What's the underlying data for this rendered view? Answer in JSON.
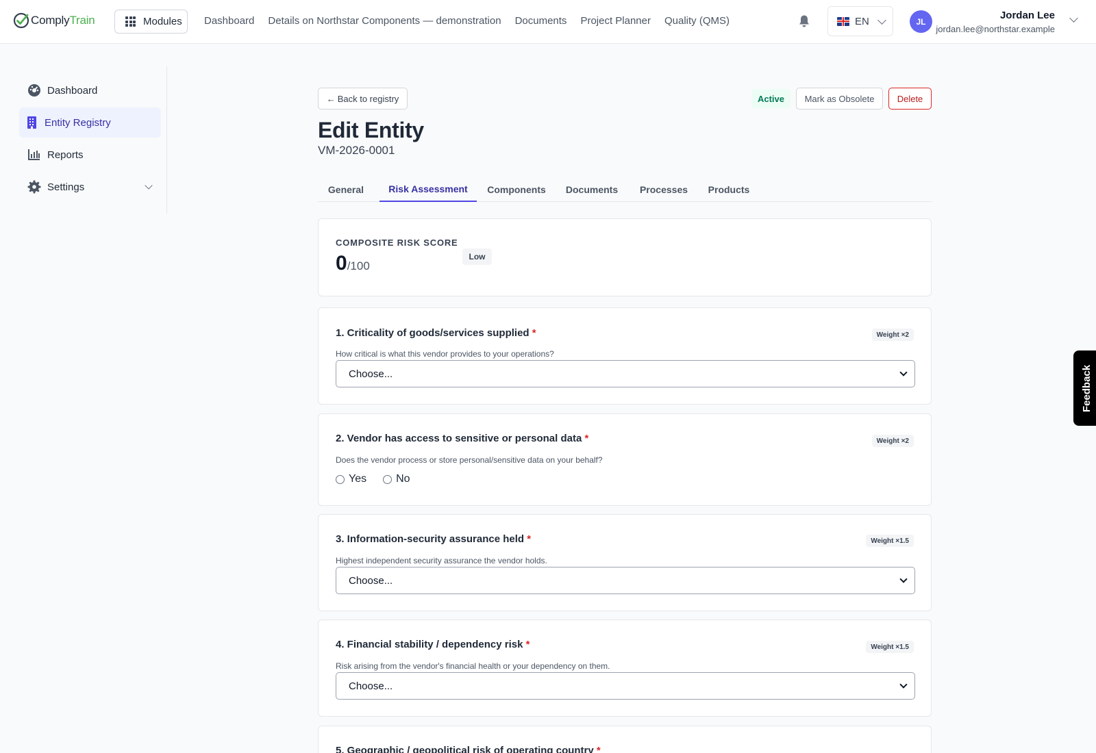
{
  "app": {
    "logo_part1": "Comply",
    "logo_part2": "Train",
    "modules_label": "Modules",
    "nav": [
      "Dashboard",
      "Details on Northstar Components — demonstration",
      "Documents",
      "Project Planner",
      "Quality (QMS)"
    ],
    "language": "EN",
    "user": {
      "initials": "JL",
      "name": "Jordan Lee",
      "email": "jordan.lee@northstar.example"
    }
  },
  "sidebar": {
    "items": [
      {
        "label": "Dashboard",
        "icon": "dashboard-icon"
      },
      {
        "label": "Entity Registry",
        "icon": "building-icon",
        "active": true
      },
      {
        "label": "Reports",
        "icon": "bar-chart-icon"
      },
      {
        "label": "Settings",
        "icon": "gear-icon"
      }
    ]
  },
  "header": {
    "back_label": "Back to registry",
    "status": "Active",
    "obsolete_label": "Mark as Obsolete",
    "delete_label": "Delete",
    "title": "Edit Entity",
    "entity_id": "VM-2026-0001"
  },
  "tabs": [
    "General",
    "Risk Assessment",
    "Components",
    "Documents",
    "Processes",
    "Products"
  ],
  "active_tab": "Risk Assessment",
  "score": {
    "label": "COMPOSITE RISK SCORE",
    "value": "0",
    "max": "/100",
    "level": "Low"
  },
  "questions": [
    {
      "title": "1. Criticality of goods/services supplied",
      "required": "*",
      "weight": "Weight ×2",
      "help": "How critical is what this vendor provides to your operations?",
      "type": "select",
      "value": "Choose..."
    },
    {
      "title": "2. Vendor has access to sensitive or personal data",
      "required": "*",
      "weight": "Weight ×2",
      "help": "Does the vendor process or store personal/sensitive data on your behalf?",
      "type": "radio",
      "options": [
        "Yes",
        "No"
      ]
    },
    {
      "title": "3. Information-security assurance held",
      "required": "*",
      "weight": "Weight ×1.5",
      "help": "Highest independent security assurance the vendor holds.",
      "type": "select",
      "value": "Choose..."
    },
    {
      "title": "4. Financial stability / dependency risk",
      "required": "*",
      "weight": "Weight ×1.5",
      "help": "Risk arising from the vendor's financial health or your dependency on them.",
      "type": "select",
      "value": "Choose..."
    },
    {
      "title": "5. Geographic / geopolitical risk of operating country",
      "required": "*"
    }
  ],
  "feedback_label": "Feedback",
  "colors": {
    "accent": "#4f46e5",
    "brand_green": "#4caf50",
    "danger": "#dc2626",
    "success": "#047857"
  }
}
